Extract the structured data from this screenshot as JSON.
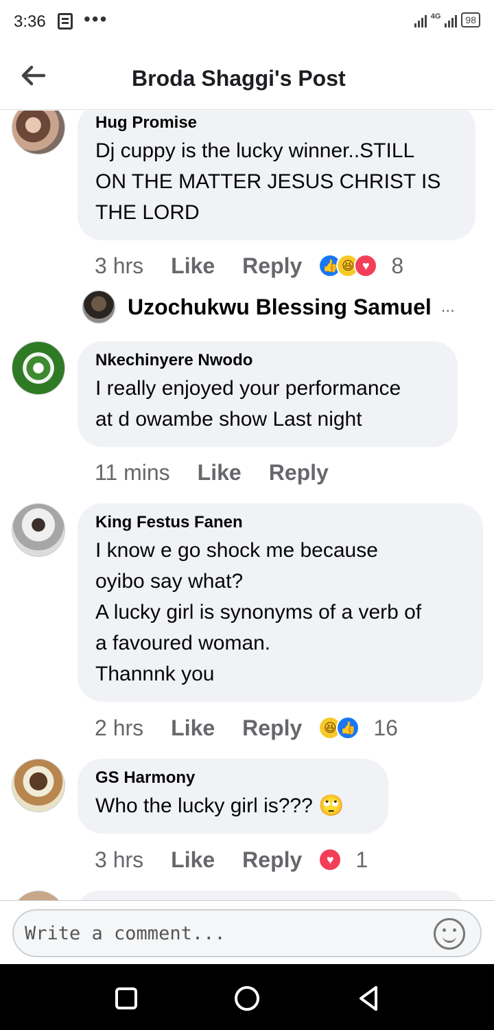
{
  "status_bar": {
    "time": "3:36",
    "dots": "•••",
    "network": "4G",
    "battery": "98"
  },
  "header": {
    "title": "Broda Shaggi's Post"
  },
  "comments": [
    {
      "author": "Hug Promise",
      "lines": [
        "Dj cuppy is the lucky winner..STILL",
        "ON THE MATTER JESUS CHRIST IS",
        "THE LORD"
      ],
      "time": "3 hrs",
      "like": "Like",
      "reply": "Reply",
      "reaction_count": "8",
      "reactions": [
        "like",
        "haha",
        "love"
      ]
    },
    {
      "author": "Nkechinyere Nwodo",
      "lines": [
        "I really enjoyed your performance",
        "at d owambe show Last night"
      ],
      "time": "11 mins",
      "like": "Like",
      "reply": "Reply"
    },
    {
      "author": "King Festus Fanen",
      "lines": [
        "I know e go shock me because",
        "oyibo say what?",
        "A lucky girl is synonyms of a verb of",
        "a favoured woman.",
        "Thannnk you"
      ],
      "time": "2 hrs",
      "like": "Like",
      "reply": "Reply",
      "reaction_count": "16",
      "reactions": [
        "haha",
        "like"
      ]
    },
    {
      "author": "GS Harmony",
      "lines": [
        "Who the lucky girl is???"
      ],
      "time": "3 hrs",
      "like": "Like",
      "reply": "Reply",
      "reaction_count": "1",
      "reactions": [
        "love"
      ]
    }
  ],
  "reply_thread": {
    "name": "Uzochukwu Blessing Samuel",
    "more": "..."
  },
  "composer": {
    "placeholder": "Write a comment..."
  },
  "colors": {
    "bubble": "#f0f2f5",
    "muted_text": "#65676b",
    "like_blue": "#1877f2",
    "love_red": "#f33e58",
    "haha_yellow": "#f7c928"
  }
}
